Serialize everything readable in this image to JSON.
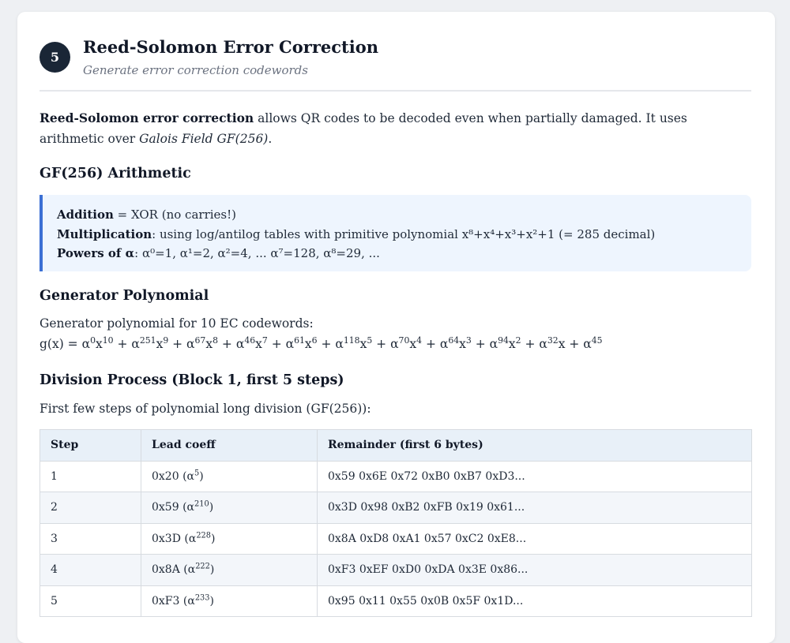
{
  "header": {
    "step_number": "5",
    "title": "Reed-Solomon Error Correction",
    "subtitle": "Generate error correction codewords"
  },
  "intro": {
    "bold_lead": "Reed-Solomon error correction",
    "text": " allows QR codes to be decoded even when partially damaged. It uses arithmetic over ",
    "italic": "Galois Field GF(256)",
    "end": "."
  },
  "arith": {
    "heading": "GF(256) Arithmetic",
    "lines": [
      {
        "label": "Addition",
        "text": " = XOR (no carries!)"
      },
      {
        "label": "Multiplication",
        "text": ": using log/antilog tables with primitive polynomial x⁸+x⁴+x³+x²+1 (= 285 decimal)"
      },
      {
        "label": "Powers of α",
        "text": ": α⁰=1, α¹=2, α²=4, ... α⁷=128, α⁸=29, ..."
      }
    ]
  },
  "generator": {
    "heading": "Generator Polynomial",
    "description": "Generator polynomial for 10 EC codewords:",
    "prefix": "g(x) = ",
    "terms": [
      {
        "exp": "0",
        "xpow": "10"
      },
      {
        "exp": "251",
        "xpow": "9"
      },
      {
        "exp": "67",
        "xpow": "8"
      },
      {
        "exp": "46",
        "xpow": "7"
      },
      {
        "exp": "61",
        "xpow": "6"
      },
      {
        "exp": "118",
        "xpow": "5"
      },
      {
        "exp": "70",
        "xpow": "4"
      },
      {
        "exp": "64",
        "xpow": "3"
      },
      {
        "exp": "94",
        "xpow": "2"
      },
      {
        "exp": "32",
        "xpow": "1"
      },
      {
        "exp": "45",
        "xpow": "0"
      }
    ]
  },
  "division": {
    "heading": "Division Process (Block 1, first 5 steps)",
    "description": "First few steps of polynomial long division (GF(256)):",
    "columns": [
      "Step",
      "Lead coeff",
      "Remainder (first 6 bytes)"
    ],
    "rows": [
      {
        "step": "1",
        "lead": "0x20",
        "alpha": "5",
        "rem": "0x59 0x6E 0x72 0xB0 0xB7 0xD3..."
      },
      {
        "step": "2",
        "lead": "0x59",
        "alpha": "210",
        "rem": "0x3D 0x98 0xB2 0xFB 0x19 0x61..."
      },
      {
        "step": "3",
        "lead": "0x3D",
        "alpha": "228",
        "rem": "0x8A 0xD8 0xA1 0x57 0xC2 0xE8..."
      },
      {
        "step": "4",
        "lead": "0x8A",
        "alpha": "222",
        "rem": "0xF3 0xEF 0xD0 0xDA 0x3E 0x86..."
      },
      {
        "step": "5",
        "lead": "0xF3",
        "alpha": "233",
        "rem": "0x95 0x11 0x55 0x0B 0x5F 0x1D..."
      }
    ]
  }
}
